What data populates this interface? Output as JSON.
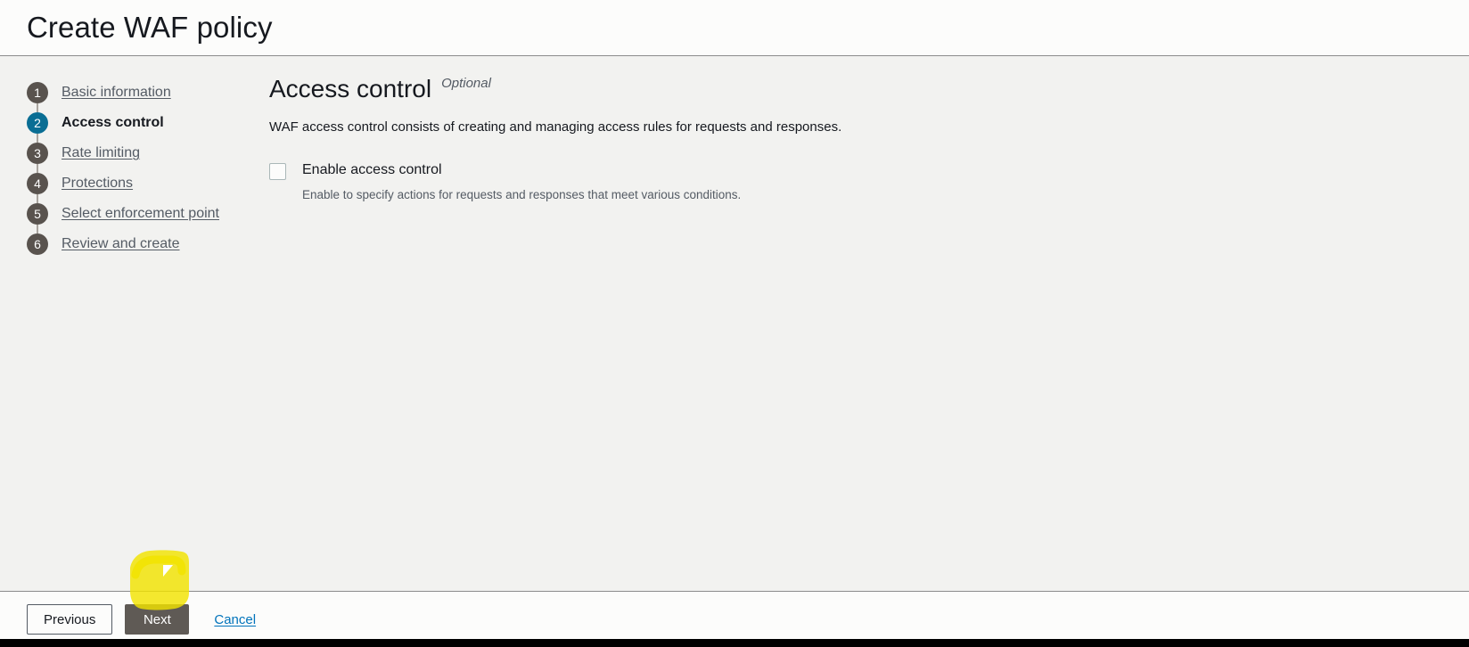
{
  "header": {
    "title": "Create WAF policy"
  },
  "sidebar": {
    "items": [
      {
        "number": "1",
        "label": "Basic information",
        "active": false
      },
      {
        "number": "2",
        "label": "Access control",
        "active": true
      },
      {
        "number": "3",
        "label": "Rate limiting",
        "active": false
      },
      {
        "number": "4",
        "label": "Protections",
        "active": false
      },
      {
        "number": "5",
        "label": "Select enforcement point",
        "active": false
      },
      {
        "number": "6",
        "label": "Review and create",
        "active": false
      }
    ]
  },
  "main": {
    "heading": "Access control",
    "optional_badge": "Optional",
    "description": "WAF access control consists of creating and managing access rules for requests and responses.",
    "checkbox": {
      "label": "Enable access control",
      "description": "Enable to specify actions for requests and responses that meet various conditions.",
      "checked": false
    }
  },
  "footer": {
    "previous_label": "Previous",
    "next_label": "Next",
    "cancel_label": "Cancel"
  },
  "colors": {
    "active_step": "#0a6e94",
    "inactive_step": "#59534e",
    "link": "#0073bb",
    "primary_button": "#5f5a55",
    "highlight": "#f2e300",
    "page_background": "#f2f2f0",
    "chrome_background": "#fcfcfb"
  },
  "annotation": {
    "highlight_target": "Next",
    "cursor_shape": "arrow-pointer"
  }
}
